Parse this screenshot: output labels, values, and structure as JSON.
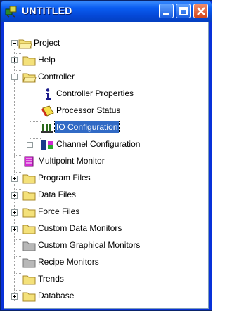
{
  "window": {
    "title": "UNTITLED"
  },
  "tree": {
    "root": "Project",
    "help": "Help",
    "controller": "Controller",
    "controller_properties": "Controller Properties",
    "processor_status": "Processor Status",
    "io_configuration": "IO Configuration",
    "channel_configuration": "Channel Configuration",
    "multipoint_monitor": "Multipoint Monitor",
    "program_files": "Program Files",
    "data_files": "Data Files",
    "force_files": "Force Files",
    "custom_data_monitors": "Custom Data Monitors",
    "custom_graphical_monitors": "Custom Graphical Monitors",
    "recipe_monitors": "Recipe Monitors",
    "trends": "Trends",
    "database": "Database"
  },
  "selected": "io_configuration",
  "colors": {
    "titlebar": "#0a5cf0",
    "selection": "#316ac5",
    "folder": "#f4e17a"
  }
}
